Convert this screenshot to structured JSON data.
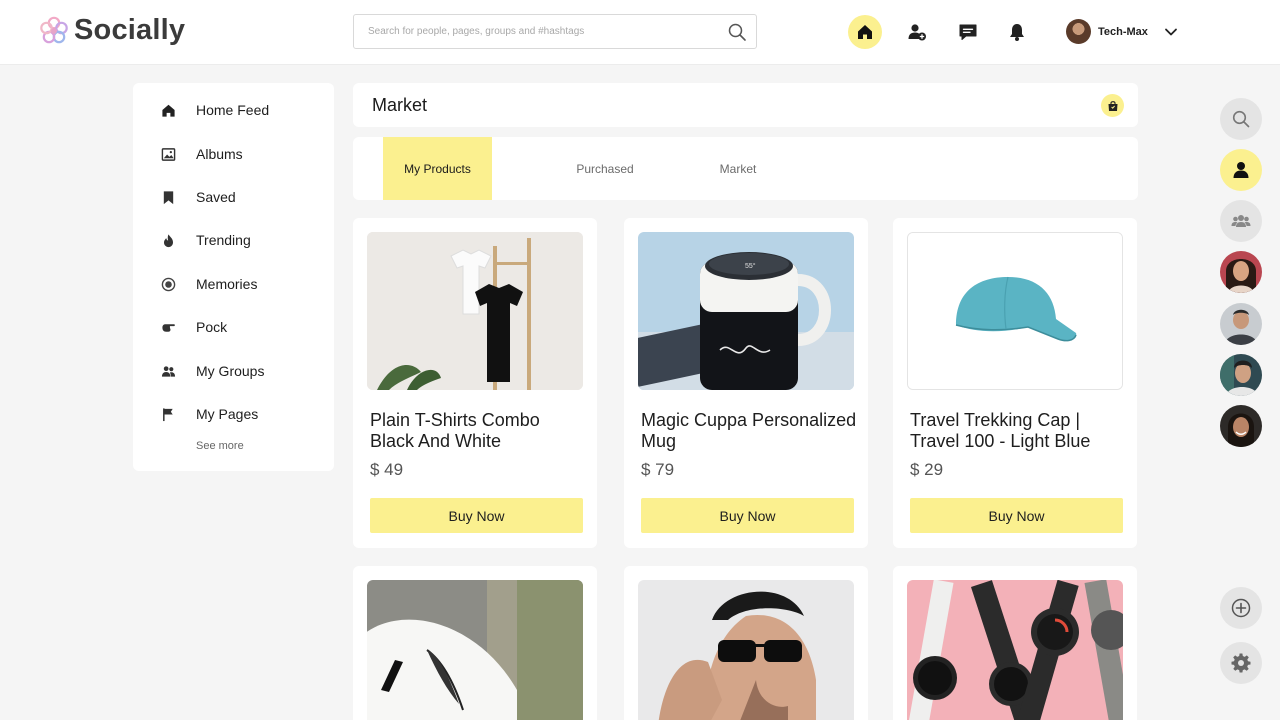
{
  "app": {
    "name": "Socially"
  },
  "search": {
    "placeholder": "Search for people, pages, groups and #hashtags"
  },
  "header": {
    "icons": [
      "home-icon",
      "add-friend-icon",
      "messages-icon",
      "notifications-icon"
    ],
    "user": {
      "name": "Tech-Max"
    }
  },
  "sidebar": {
    "items": [
      {
        "label": "Home Feed",
        "icon": "home-icon"
      },
      {
        "label": "Albums",
        "icon": "albums-icon"
      },
      {
        "label": "Saved",
        "icon": "bookmark-icon"
      },
      {
        "label": "Trending",
        "icon": "flame-icon"
      },
      {
        "label": "Memories",
        "icon": "memories-icon"
      },
      {
        "label": "Pock",
        "icon": "poke-hand-icon"
      },
      {
        "label": "My Groups",
        "icon": "groups-icon"
      },
      {
        "label": "My Pages",
        "icon": "flag-icon"
      }
    ],
    "see_more": "See more"
  },
  "market": {
    "title": "Market",
    "tabs": [
      "My Products",
      "Purchased",
      "Market"
    ],
    "active_tab": "My Products"
  },
  "products": [
    {
      "name": "Plain T-Shirts Combo Black And White",
      "price": "$ 49",
      "button": "Buy Now"
    },
    {
      "name": "Magic Cuppa Personalized Mug",
      "price": "$ 79",
      "button": "Buy Now"
    },
    {
      "name": "Travel Trekking Cap | Travel 100 - Light Blue",
      "price": "$ 29",
      "button": "Buy Now"
    },
    {
      "name": "",
      "price": "",
      "button": ""
    },
    {
      "name": "",
      "price": "",
      "button": ""
    },
    {
      "name": "",
      "price": "",
      "button": ""
    }
  ],
  "colors": {
    "accent": "#fbf08f",
    "background": "#f5f5f5"
  }
}
